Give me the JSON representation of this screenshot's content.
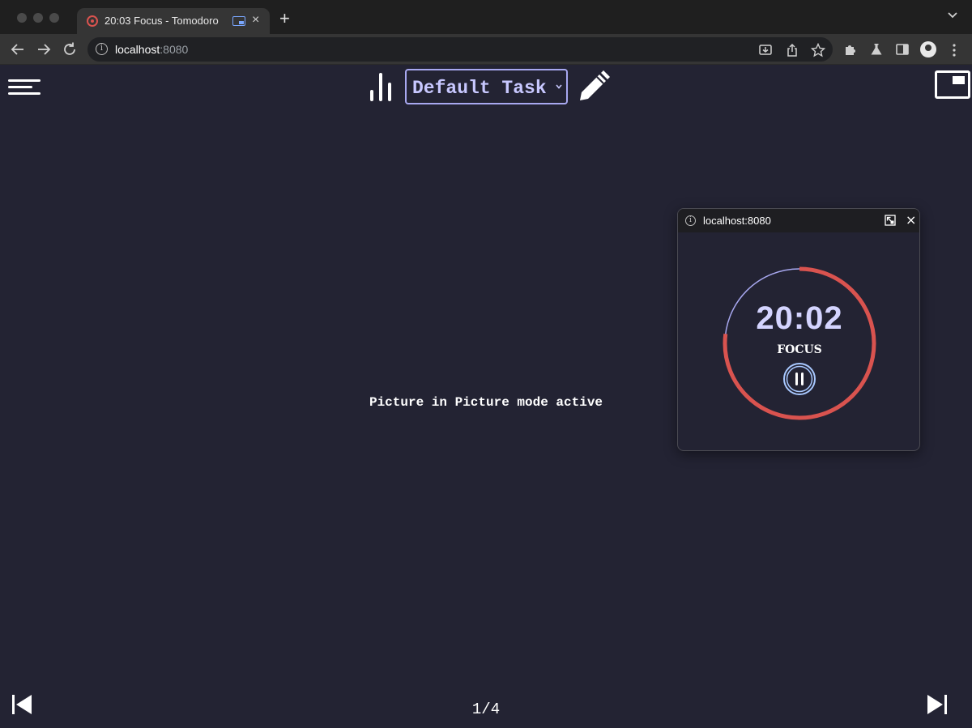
{
  "browser": {
    "tab": {
      "title": "20:03 Focus - Tomodoro",
      "close_glyph": "×"
    },
    "new_tab_glyph": "+",
    "address": {
      "host": "localhost",
      "port": ":8080"
    },
    "icons": [
      "back-icon",
      "forward-icon",
      "reload-icon",
      "install-icon",
      "share-icon",
      "bookmark-star-icon",
      "extensions-icon",
      "labs-icon",
      "side-panel-icon",
      "profile-icon"
    ]
  },
  "app": {
    "task_select": {
      "value": "Default Task"
    },
    "main_message": "Picture in Picture mode active",
    "page_indicator": "1/4",
    "colors": {
      "background": "#232333",
      "accent": "#a8a8f0",
      "ring_progress": "#d9534f",
      "ring_track": "#a8a8f0"
    }
  },
  "pip_window": {
    "host": "localhost:8080",
    "timer": "20:02",
    "phase": "FOCUS",
    "elapsed_fraction": 0.23,
    "close_glyph": "×"
  }
}
